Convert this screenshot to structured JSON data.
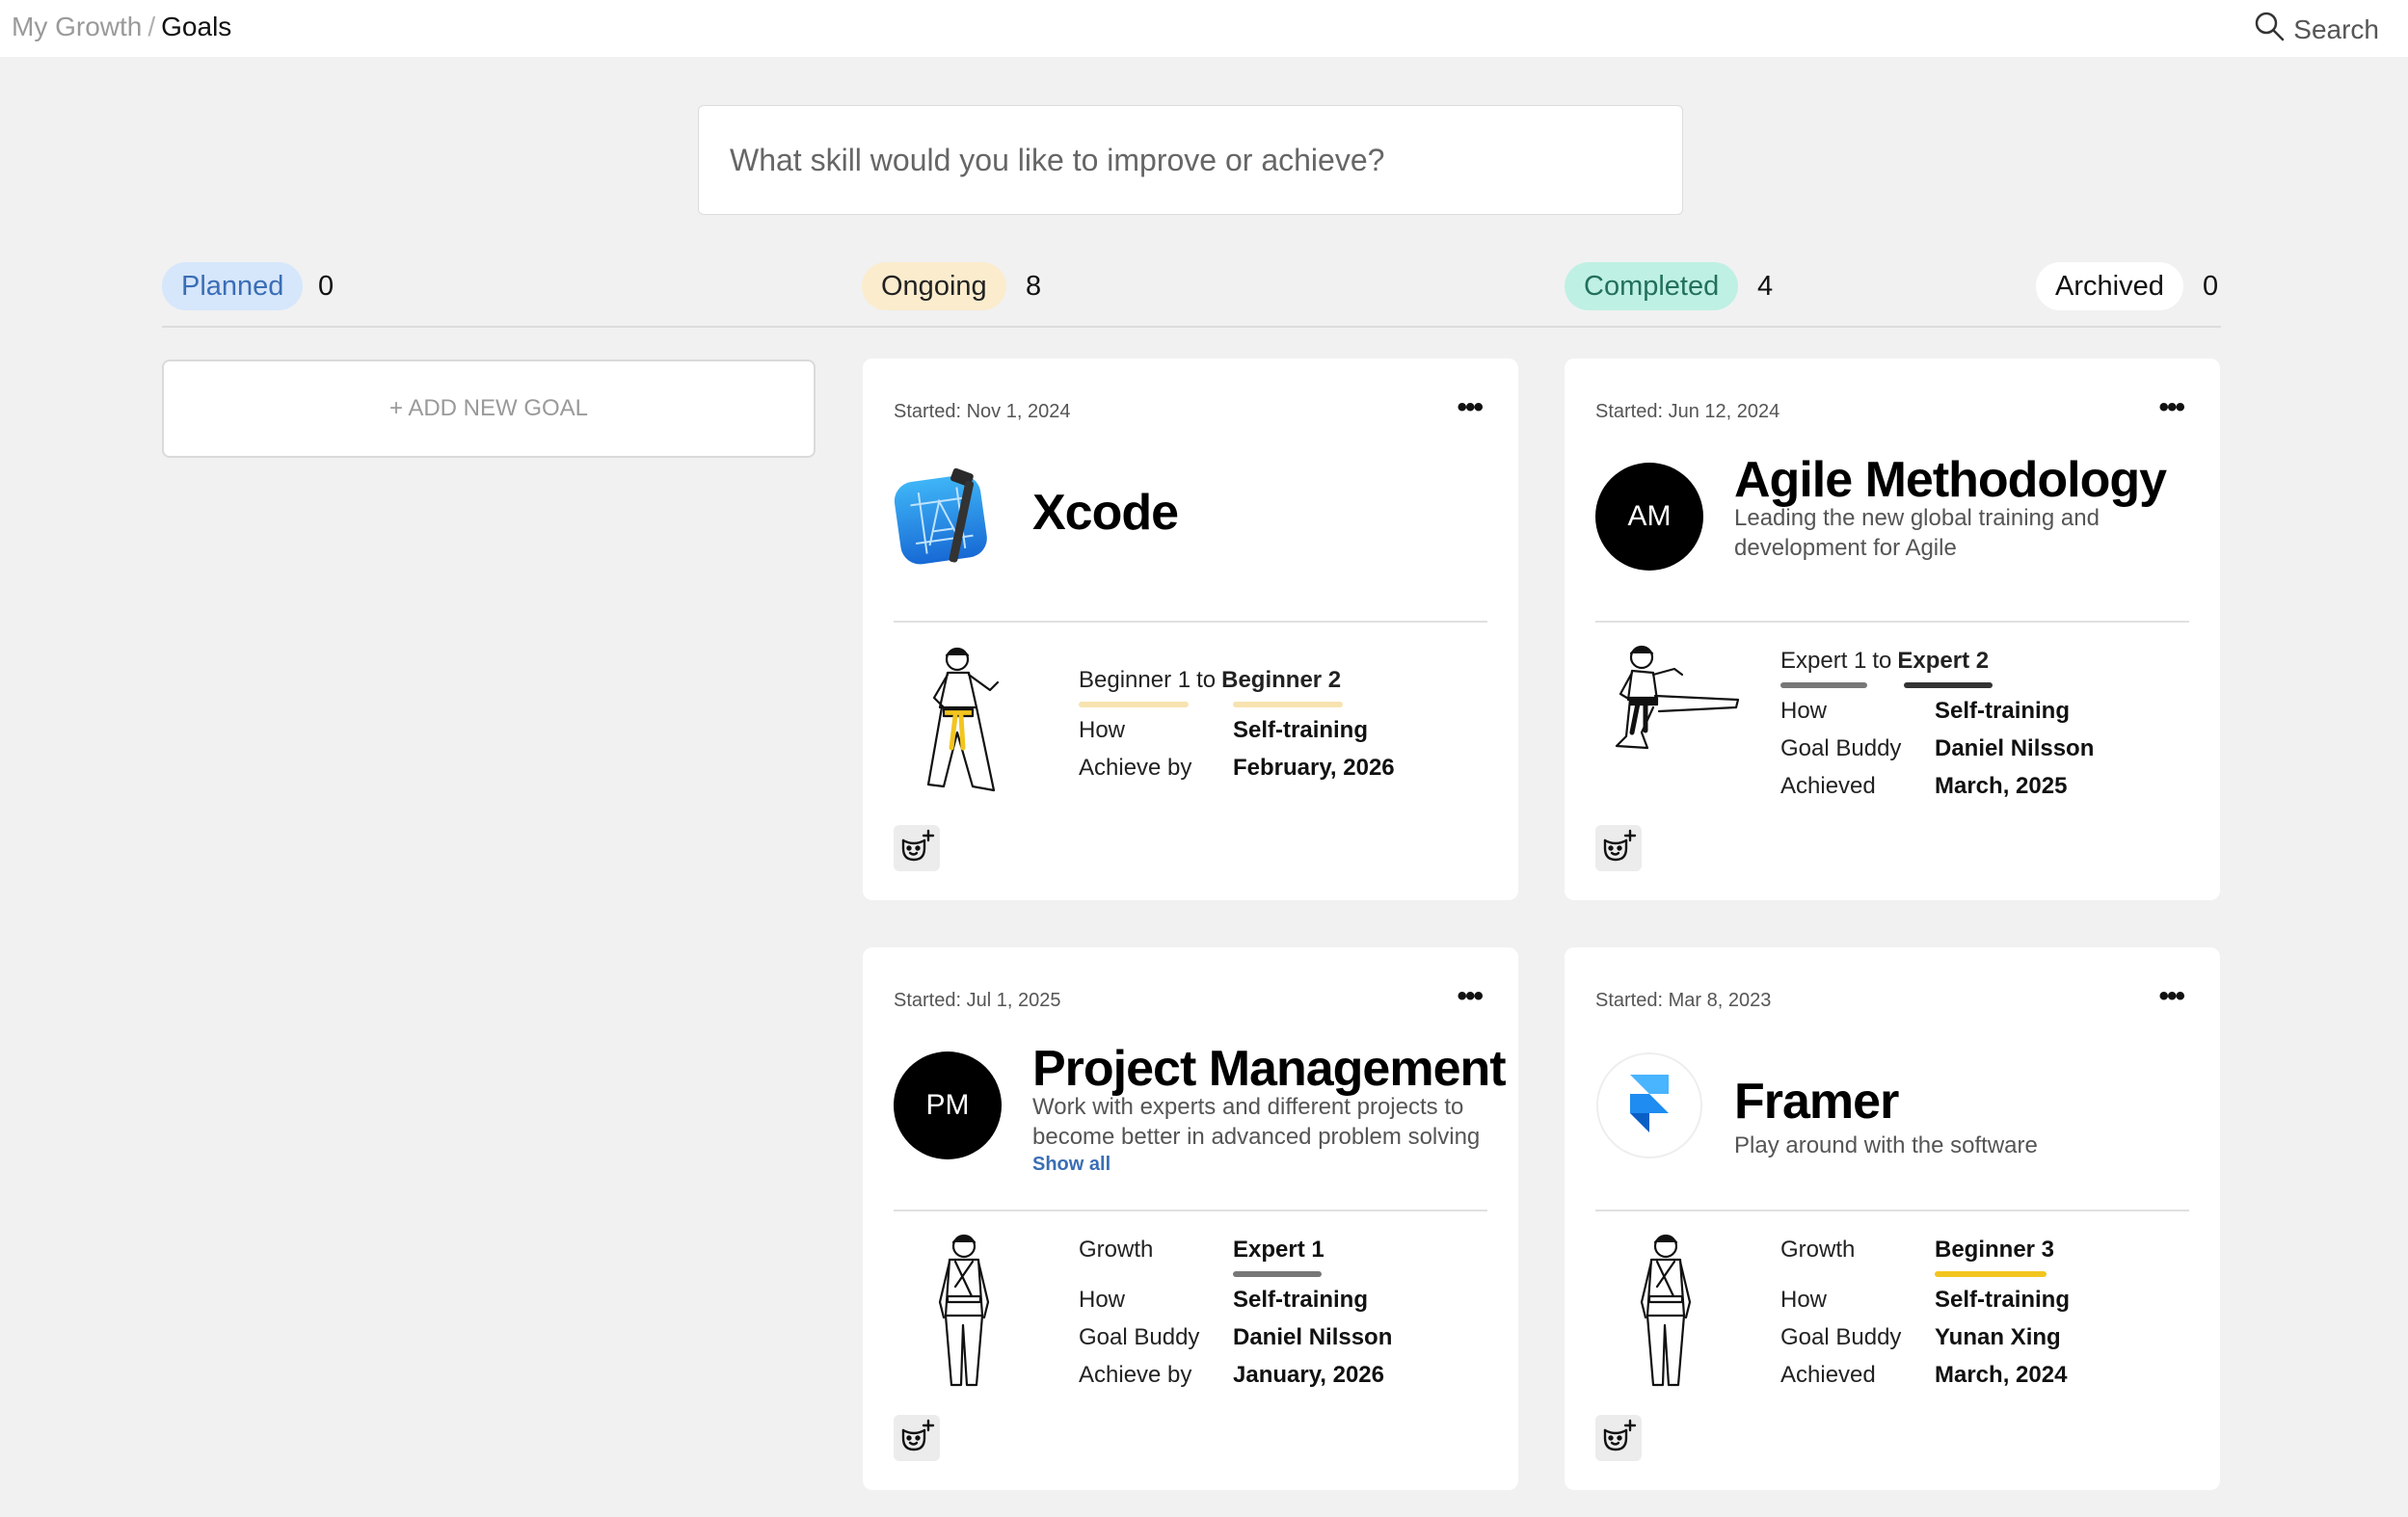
{
  "breadcrumb": {
    "parent": "My Growth",
    "separator": "/",
    "current": "Goals"
  },
  "search": {
    "label": "Search",
    "icon": "search-icon"
  },
  "skill_input": {
    "placeholder": "What skill would you like to improve or achieve?"
  },
  "statuses": [
    {
      "label": "Planned",
      "count": "0"
    },
    {
      "label": "Ongoing",
      "count": "8"
    },
    {
      "label": "Completed",
      "count": "4"
    },
    {
      "label": "Archived",
      "count": "0"
    }
  ],
  "add_goal": {
    "label": "+ ADD NEW GOAL"
  },
  "cards": [
    {
      "started": "Started: Nov 1, 2024",
      "title": "Xcode",
      "logo": "xcode-icon",
      "level_from": "Beginner 1",
      "level_to_word": "to",
      "level_to": "Beginner 2",
      "rows": [
        {
          "label": "How",
          "value": "Self-training"
        },
        {
          "label": "Achieve by",
          "value": "February, 2026"
        }
      ]
    },
    {
      "started": "Started: Jun 12, 2024",
      "title": "Agile Methodology",
      "avatar": "AM",
      "description": "Leading the new global training and development for Agile",
      "level_from": "Expert 1",
      "level_to_word": "to",
      "level_to": "Expert 2",
      "rows": [
        {
          "label": "How",
          "value": "Self-training"
        },
        {
          "label": "Goal Buddy",
          "value": "Daniel Nilsson"
        },
        {
          "label": "Achieved",
          "value": "March, 2025"
        }
      ]
    },
    {
      "started": "Started: Jul 1, 2025",
      "title": "Project Management",
      "avatar": "PM",
      "description": "Work with experts and different projects to become better in advanced problem solving",
      "show_all": "Show all",
      "growth_label": "Growth",
      "growth_value": "Expert 1",
      "rows": [
        {
          "label": "How",
          "value": "Self-training"
        },
        {
          "label": "Goal Buddy",
          "value": "Daniel Nilsson"
        },
        {
          "label": "Achieve by",
          "value": "January, 2026"
        }
      ]
    },
    {
      "started": "Started: Mar 8, 2023",
      "title": "Framer",
      "logo": "framer-icon",
      "description": "Play around with the software",
      "growth_label": "Growth",
      "growth_value": "Beginner 3",
      "rows": [
        {
          "label": "How",
          "value": "Self-training"
        },
        {
          "label": "Goal Buddy",
          "value": "Yunan Xing"
        },
        {
          "label": "Achieved",
          "value": "March, 2024"
        }
      ]
    }
  ],
  "colors": {
    "planned": "#d6e6fb",
    "ongoing": "#fbeccd",
    "completed": "#bff0e4",
    "beginner_bar": "#f7e3b0",
    "beginner3_bar": "#f2c51f",
    "expert_from_bar": "#777777",
    "expert_to_bar": "#333333"
  }
}
